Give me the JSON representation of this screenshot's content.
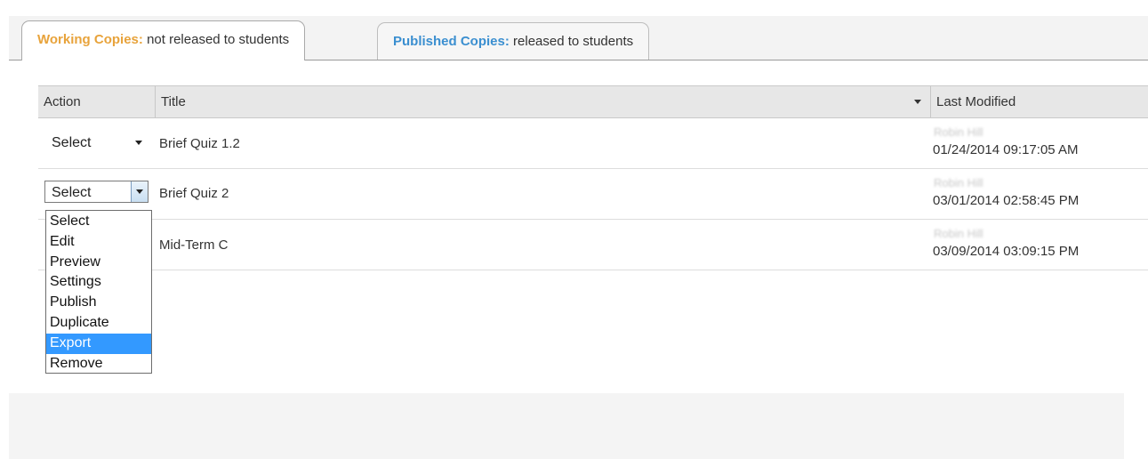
{
  "tabs": [
    {
      "prefix": "Working Copies:",
      "rest": " not released to students"
    },
    {
      "prefix": "Published Copies:",
      "rest": " released to students"
    }
  ],
  "table": {
    "headers": {
      "action": "Action",
      "title": "Title",
      "modified": "Last Modified"
    },
    "rows": [
      {
        "select": "Select",
        "title": "Brief Quiz 1.2",
        "author": "Robin Hill",
        "date": "01/24/2014 09:17:05 AM"
      },
      {
        "select": "Select",
        "title": "Brief Quiz 2",
        "author": "Robin Hill",
        "date": "03/01/2014 02:58:45 PM"
      },
      {
        "select": "",
        "title": "Mid-Term C",
        "author": "Robin Hill",
        "date": "03/09/2014 03:09:15 PM"
      }
    ]
  },
  "dropdown": {
    "options": [
      "Select",
      "Edit",
      "Preview",
      "Settings",
      "Publish",
      "Duplicate",
      "Export",
      "Remove"
    ],
    "highlighted": "Export"
  },
  "colors": {
    "working_accent": "#e8a33b",
    "published_accent": "#3b8fd0",
    "highlight": "#3399ff"
  },
  "icons": {
    "sort": "sort-down-icon",
    "dropdown_arrow": "chevron-down-icon"
  }
}
